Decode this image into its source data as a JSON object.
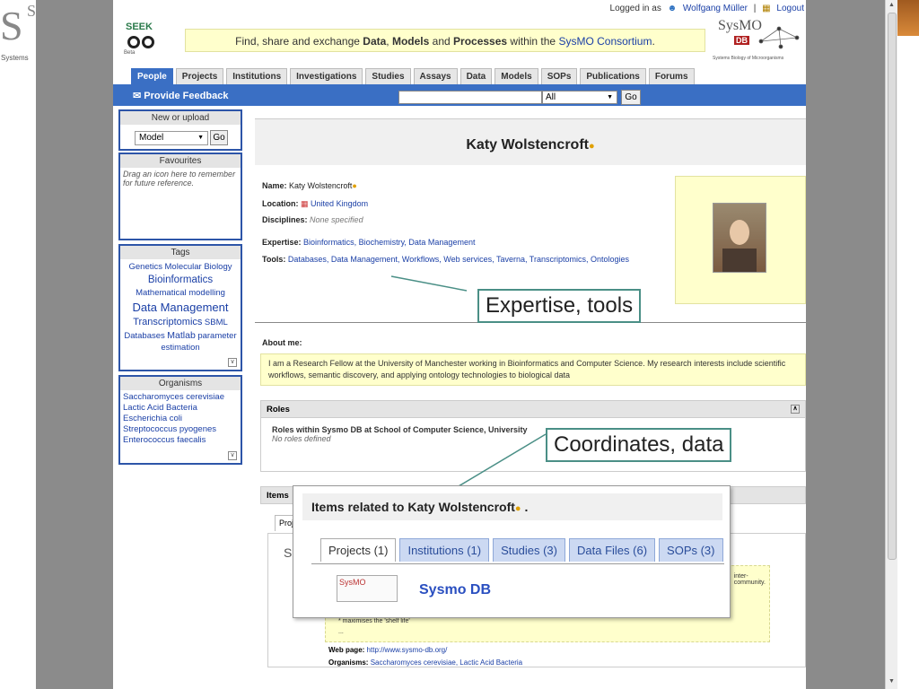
{
  "left_logo": {
    "top": "Sys",
    "big": "S",
    "bottom": "Systems"
  },
  "header": {
    "logged_in_prefix": "Logged in as",
    "user": "Wolfgang Müller",
    "separator": "|",
    "logout": "Logout",
    "logo_text": "SEEK",
    "logo_beta": "Beta",
    "tagline_pre": "Find, share and exchange ",
    "tagline_data": "Data",
    "tagline_comma": ", ",
    "tagline_models": "Models",
    "tagline_and": " and ",
    "tagline_processes": "Processes",
    "tagline_post": " within the ",
    "tagline_link": "SysMO Consortium",
    "tagline_end": ".",
    "sysmo_logo": "SysMO",
    "sysmo_db": "DB",
    "sysmo_sub": "Systems Biology of Microorganisms"
  },
  "nav_tabs": [
    "People",
    "Projects",
    "Institutions",
    "Investigations",
    "Studies",
    "Assays",
    "Data",
    "Models",
    "SOPs",
    "Publications",
    "Forums"
  ],
  "toolbar": {
    "feedback": "Provide Feedback",
    "search_value": "",
    "select_value": "All",
    "go": "Go"
  },
  "sidebar": {
    "new_upload": {
      "title": "New or upload",
      "select": "Model",
      "go": "Go"
    },
    "favourites": {
      "title": "Favourites",
      "hint": "Drag an icon here to remember for future reference."
    },
    "tags": {
      "title": "Tags",
      "items": [
        "Genetics",
        "Molecular Biology",
        "Bioinformatics",
        "Mathematical modelling",
        "Data Management",
        "Transcriptomics",
        "SBML",
        "Databases",
        "Matlab",
        "parameter estimation"
      ]
    },
    "organisms": {
      "title": "Organisms",
      "items": [
        "Saccharomyces cerevisiae",
        "Lactic Acid Bacteria",
        "Escherichia coli",
        "Streptococcus pyogenes",
        "Enterococcus faecalis"
      ]
    }
  },
  "profile": {
    "name": "Katy Wolstencroft",
    "name_label": "Name:",
    "location_label": "Location:",
    "location": "United Kingdom",
    "disciplines_label": "Disciplines:",
    "disciplines": "None specified",
    "expertise_label": "Expertise:",
    "expertise": "Bioinformatics, Biochemistry, Data Management",
    "tools_label": "Tools:",
    "tools": "Databases, Data Management, Workflows, Web services, Taverna, Transcriptomics, Ontologies",
    "about_label": "About me:",
    "about": "I am a Research Fellow at the University of Manchester working in Bioinformatics and Computer Science. My research interests include scientific workflows, semantic discovery, and applying ontology technologies to biological data",
    "roles_title": "Roles",
    "roles_text": "Roles within Sysmo DB at School of Computer Science, University",
    "roles_none": "No roles defined",
    "items_title": "Items",
    "proj_tab": "Proj"
  },
  "callouts": {
    "expertise": "Expertise, tools",
    "coordinates": "Coordinates, data"
  },
  "zoom": {
    "title": "Items related to Katy Wolstencroft",
    "title_end": ".",
    "tabs": [
      "Projects (1)",
      "Institutions (1)",
      "Studies (3)",
      "Data Files (6)",
      "SOPs (3)"
    ],
    "project_name": "Sysmo DB",
    "logo_text": "SysMO"
  },
  "below_zoom": {
    "snip_inter": "inter-",
    "snip_community": "community.",
    "shelf": "* maximises the 'shelf life'",
    "ellipsis": "...",
    "web_label": "Web page:",
    "web": "http://www.sysmo-db.org/",
    "org_label": "Organisms:",
    "orgs": "Saccharomyces cerevisiae, Lactic Acid Bacteria",
    "tab_letter": "S"
  }
}
